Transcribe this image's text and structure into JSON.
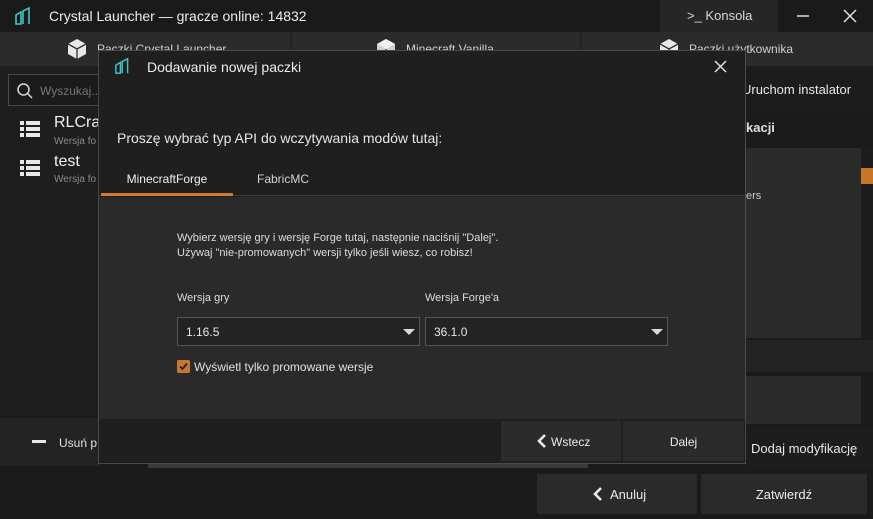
{
  "window": {
    "title": "Crystal Launcher — gracze online: 14832",
    "console_label": ">_ Konsola",
    "logo_icon": "crystal-launcher-logo-icon",
    "accent_color": "#d17a2c"
  },
  "top_tabs": [
    {
      "label": "Paczki Crystal Launcher",
      "icon": "cube-icon"
    },
    {
      "label": "Minecraft Vanilla",
      "icon": "grass-block-icon"
    },
    {
      "label": "Paczki użytkownika",
      "icon": "user-cube-icon"
    }
  ],
  "search": {
    "placeholder": "Wyszukaj..."
  },
  "packs": [
    {
      "name": "RLCra",
      "sub": "Wersja fo"
    },
    {
      "name": "test",
      "sub": "Wersja fo"
    }
  ],
  "left_bottom": {
    "remove_label": "Usuń p"
  },
  "right_pane": {
    "run_installer": "Uruchom instalator",
    "section_title": "kacji",
    "list_text": "ers",
    "add_mod_label": "Dodaj modyfikację"
  },
  "bottom_bar": {
    "cancel_label": "Anuluj",
    "confirm_label": "Zatwierdź"
  },
  "dialog": {
    "title": "Dodawanie nowej paczki",
    "prompt": "Proszę wybrać typ API do wczytywania modów tutaj:",
    "tabs": [
      {
        "label": "MinecraftForge",
        "active": true
      },
      {
        "label": "FabricMC",
        "active": false
      }
    ],
    "instructions_line1": "Wybierz wersję gry i wersję Forge tutaj, następnie naciśnij \"Dalej\".",
    "instructions_line2": "Używaj \"nie-promowanych\" wersji tylko jeśli wiesz, co robisz!",
    "game_version_label": "Wersja gry",
    "game_version_value": "1.16.5",
    "forge_version_label": "Wersja Forge'a",
    "forge_version_value": "36.1.0",
    "checkbox_label": "Wyświetl tylko promowane wersje",
    "checkbox_checked": true,
    "back_label": "Wstecz",
    "next_label": "Dalej"
  }
}
